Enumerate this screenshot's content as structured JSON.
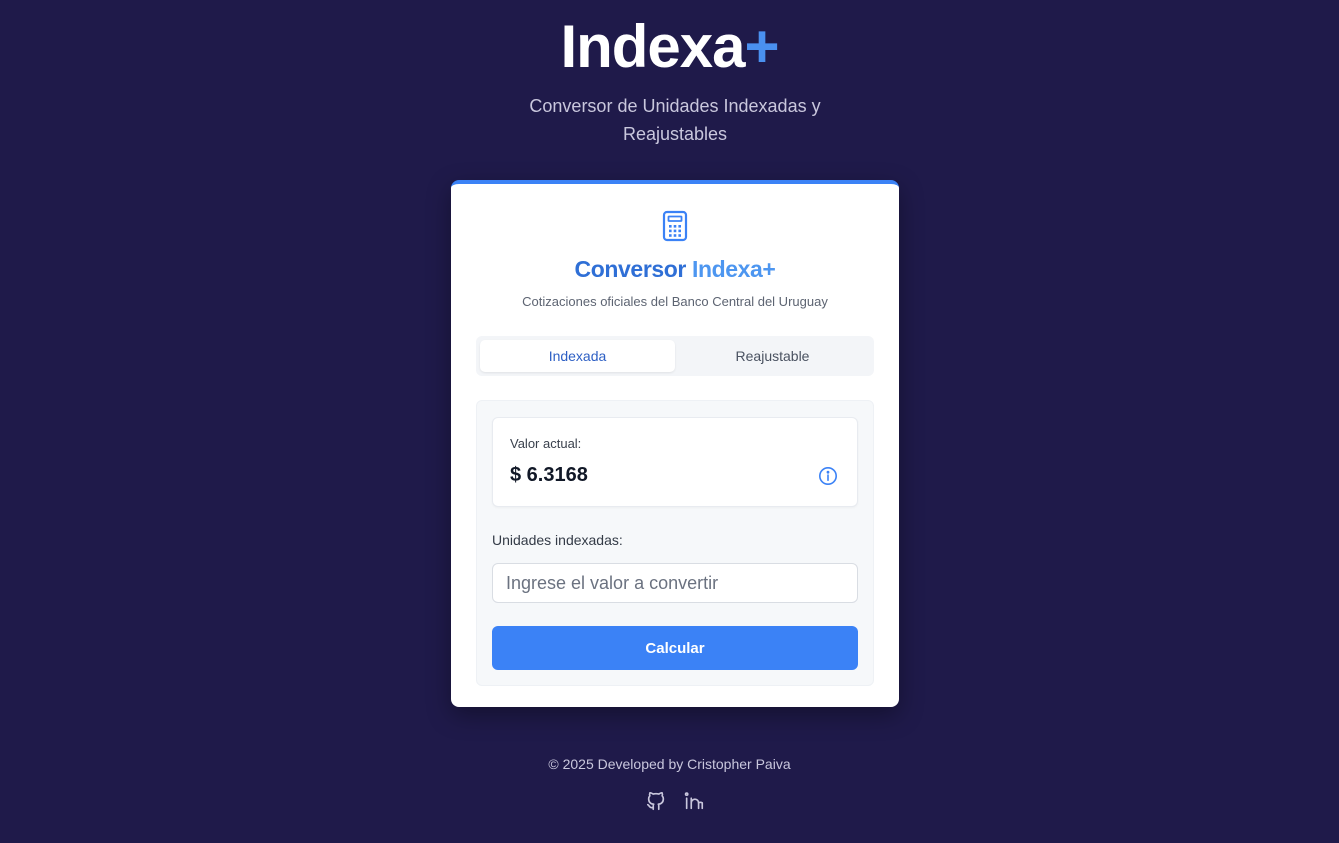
{
  "brand": {
    "name": "Indexa",
    "plus": "+"
  },
  "subtitle": "Conversor de Unidades Indexadas y Reajustables",
  "card": {
    "title_part1": "Conversor",
    "title_part2": "Indexa+",
    "subtitle": "Cotizaciones oficiales del Banco Central del Uruguay",
    "icon": "calculator-icon"
  },
  "tabs": [
    {
      "label": "Indexada",
      "active": true
    },
    {
      "label": "Reajustable",
      "active": false
    }
  ],
  "converter": {
    "current_value_label": "Valor actual:",
    "current_value": "$ 6.3168",
    "info_icon": "info-icon",
    "units_label": "Unidades indexadas:",
    "units_value": "",
    "units_placeholder": "Ingrese el valor a convertir",
    "button_label": "Calcular"
  },
  "footer": {
    "text": "© 2025 Developed by Cristopher Paiva",
    "icons": [
      "github-icon",
      "linkedin-icon"
    ]
  },
  "colors": {
    "background": "#1f1a4a",
    "accent": "#3b82f6",
    "title_blue": "#2f6fd6"
  }
}
